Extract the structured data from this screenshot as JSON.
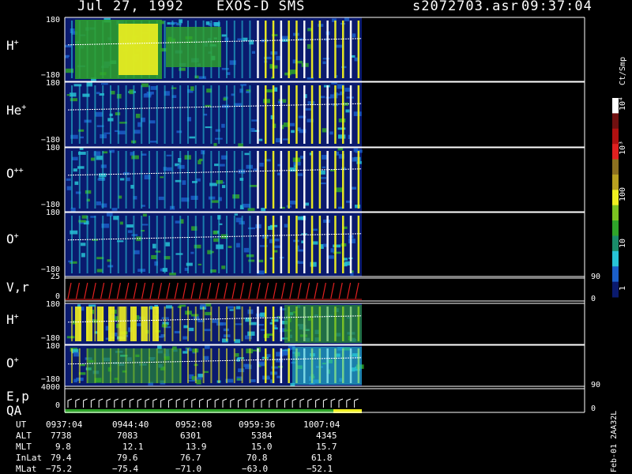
{
  "header": {
    "date": "Jul 27, 1992",
    "instrument": "EXOS-D SMS",
    "file": "s2072703.asr",
    "time": "09:37:04"
  },
  "chart_data": {
    "type": "heatmap",
    "panels": [
      {
        "label": "H",
        "sup": "+",
        "ylim": [
          -180,
          180
        ],
        "yticks": [
          "180",
          "−180"
        ]
      },
      {
        "label": "He",
        "sup": "+",
        "ylim": [
          -180,
          180
        ],
        "yticks": [
          "180",
          "−180"
        ]
      },
      {
        "label": "O",
        "sup": "++",
        "ylim": [
          -180,
          180
        ],
        "yticks": [
          "180",
          "−180"
        ]
      },
      {
        "label": "O",
        "sup": "+",
        "ylim": [
          -180,
          180
        ],
        "yticks": [
          "180",
          "−180"
        ]
      },
      {
        "label": "V,r",
        "sup": "",
        "ylim": [
          0,
          25
        ],
        "yticks": [
          "25",
          "0"
        ],
        "right_ticks": [
          "90",
          "0"
        ]
      },
      {
        "label": "H",
        "sup": "+",
        "ylim": [
          -180,
          180
        ],
        "yticks": [
          "180",
          "−180"
        ]
      },
      {
        "label": "O",
        "sup": "+",
        "ylim": [
          -180,
          180
        ],
        "yticks": [
          "180",
          "−180"
        ]
      },
      {
        "label": "E,p",
        "label2": "QA",
        "sup": "",
        "ylim": [
          0,
          4000
        ],
        "yticks": [
          "4000",
          "0"
        ],
        "right_ticks": [
          "90",
          "0"
        ]
      }
    ],
    "colorbar": {
      "unit": "Ct/Smp",
      "scale": "log",
      "range": [
        1,
        10000
      ],
      "tick_labels": [
        "10⁴",
        "10³",
        "100",
        "10",
        "1"
      ]
    },
    "x_axis": {
      "rows": [
        {
          "label": "UT",
          "values": [
            "0937:04",
            "0944:40",
            "0952:08",
            "0959:36",
            "1007:04"
          ]
        },
        {
          "label": "ALT",
          "values": [
            "7738",
            "7083",
            "6301",
            "5384",
            "4345"
          ]
        },
        {
          "label": "MLT",
          "values": [
            "9.8",
            "12.1",
            "13.9",
            "15.0",
            "15.7"
          ]
        },
        {
          "label": "InLat",
          "values": [
            "79.4",
            "79.6",
            "76.7",
            "70.8",
            "61.8"
          ]
        },
        {
          "label": "MLat",
          "values": [
            "−75.2",
            "−75.4",
            "−71.0",
            "−63.0",
            "−52.1"
          ]
        }
      ]
    }
  },
  "side_note": "Feb-01 2AA32L",
  "colors": {
    "background": "#000000",
    "low": "#0a1a6e",
    "mid_blue": "#1b5fc8",
    "cyan": "#27c3d6",
    "green": "#2fa52a",
    "yellow": "#f0f020",
    "red": "#e02020",
    "white": "#ffffff"
  }
}
